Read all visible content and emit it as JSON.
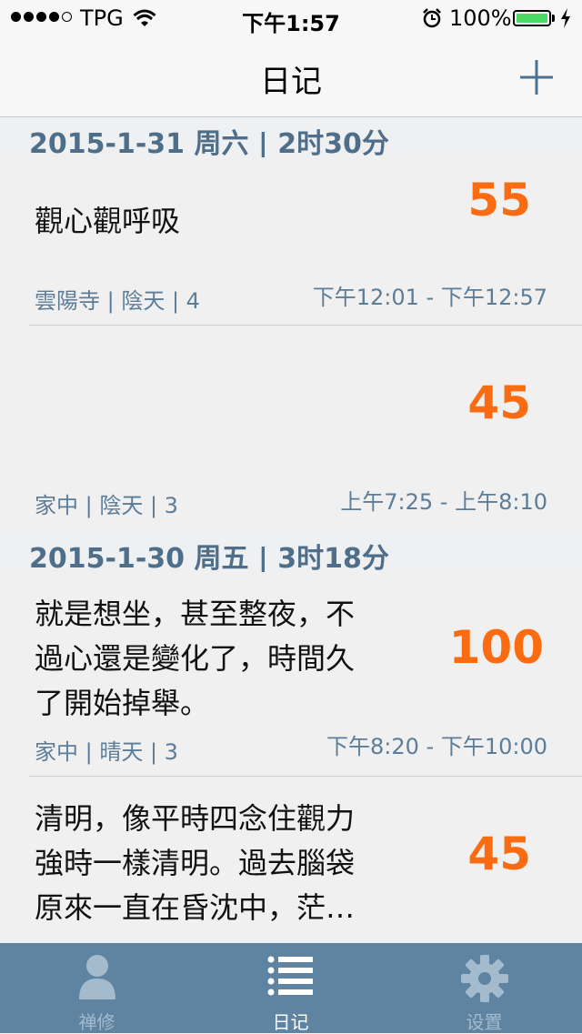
{
  "status_bar": {
    "carrier": "TPG",
    "time": "下午1:57",
    "battery": "100%"
  },
  "nav": {
    "title": "日记",
    "add_icon": "plus-icon"
  },
  "sections": [
    {
      "title": "2015-1-31 周六 | 2时30分",
      "entries": [
        {
          "text": "觀心觀呼吸",
          "score": "55",
          "meta": "雲陽寺 | 陰天 | 4",
          "time": "下午12:01 - 下午12:57"
        },
        {
          "text": "",
          "score": "45",
          "meta": "家中 | 陰天 | 3",
          "time": "上午7:25 - 上午8:10"
        }
      ]
    },
    {
      "title": "2015-1-30 周五 | 3时18分",
      "entries": [
        {
          "text": "就是想坐，甚至整夜，不過心還是變化了，時間久了開始掉舉。",
          "score": "100",
          "meta": "家中 | 晴天 | 3",
          "time": "下午8:20 - 下午10:00"
        },
        {
          "text": "清明，像平時四念住觀力強時一樣清明。過去腦袋原來一直在昏沈中，茫…",
          "score": "45",
          "meta": "",
          "time": ""
        }
      ]
    }
  ],
  "tabs": [
    {
      "label": "禅修",
      "icon": "person-icon",
      "active": false
    },
    {
      "label": "日记",
      "icon": "list-icon",
      "active": true
    },
    {
      "label": "设置",
      "icon": "gear-icon",
      "active": false
    }
  ],
  "colors": {
    "accent": "#4e6e8a",
    "score": "#fb6c12",
    "tab_bar": "#5e84a1",
    "meta": "#5c7d98",
    "battery": "#4cd964"
  }
}
